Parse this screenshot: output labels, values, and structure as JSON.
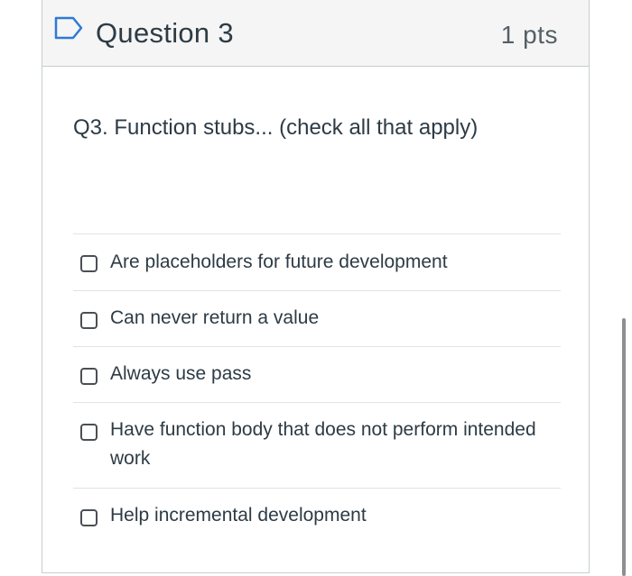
{
  "question": {
    "title": "Question 3",
    "points": "1 pts",
    "text": "Q3. Function stubs... (check all that apply)",
    "flag_icon": "flag-outline-icon"
  },
  "answers": [
    {
      "label": "Are placeholders for future development",
      "checked": false
    },
    {
      "label": "Can never return a value",
      "checked": false
    },
    {
      "label": "Always use pass",
      "checked": false
    },
    {
      "label": "Have function body that does not perform intended work",
      "checked": false
    },
    {
      "label": "Help incremental development",
      "checked": false
    }
  ],
  "colors": {
    "accent": "#2d7ad6",
    "text": "#2d3b45",
    "border": "#c7cdd1",
    "header_bg": "#f5f5f5"
  }
}
